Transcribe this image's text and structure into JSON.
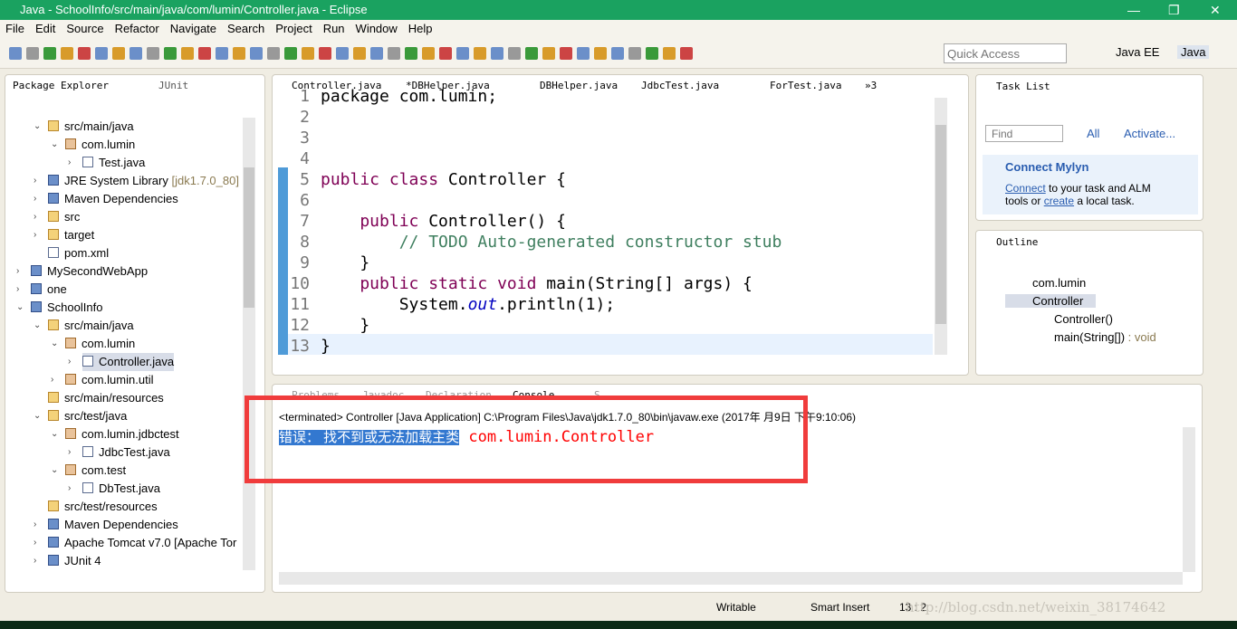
{
  "window": {
    "title": "Java - SchoolInfo/src/main/java/com/lumin/Controller.java - Eclipse"
  },
  "menu": [
    "File",
    "Edit",
    "Source",
    "Refactor",
    "Navigate",
    "Search",
    "Project",
    "Run",
    "Window",
    "Help"
  ],
  "quick_access": {
    "placeholder": "Quick Access"
  },
  "perspectives": [
    "Java EE",
    "Java"
  ],
  "package_explorer": {
    "tabs": [
      "Package Explorer",
      "JUnit"
    ],
    "items": [
      {
        "label": "src/main/java",
        "type": "folder",
        "depth": 1,
        "open": true
      },
      {
        "label": "com.lumin",
        "type": "package",
        "depth": 2,
        "open": true
      },
      {
        "label": "Test.java",
        "type": "java",
        "depth": 3
      },
      {
        "label": "JRE System Library",
        "suffix": "[jdk1.7.0_80]",
        "type": "lib",
        "depth": 1
      },
      {
        "label": "Maven Dependencies",
        "type": "lib",
        "depth": 1
      },
      {
        "label": "src",
        "type": "folder",
        "depth": 1
      },
      {
        "label": "target",
        "type": "folder",
        "depth": 1
      },
      {
        "label": "pom.xml",
        "type": "file",
        "depth": 1,
        "leaf": true
      },
      {
        "label": "MySecondWebApp",
        "type": "project",
        "depth": 0
      },
      {
        "label": "one",
        "type": "project",
        "depth": 0
      },
      {
        "label": "SchoolInfo",
        "type": "project",
        "depth": 0,
        "open": true
      },
      {
        "label": "src/main/java",
        "type": "folder",
        "depth": 1,
        "open": true
      },
      {
        "label": "com.lumin",
        "type": "package",
        "depth": 2,
        "open": true
      },
      {
        "label": "Controller.java",
        "type": "java",
        "depth": 3,
        "selected": true
      },
      {
        "label": "com.lumin.util",
        "type": "package",
        "depth": 2
      },
      {
        "label": "src/main/resources",
        "type": "folder",
        "depth": 1,
        "leaf": true
      },
      {
        "label": "src/test/java",
        "type": "folder",
        "depth": 1,
        "open": true
      },
      {
        "label": "com.lumin.jdbctest",
        "type": "package",
        "depth": 2,
        "open": true
      },
      {
        "label": "JdbcTest.java",
        "type": "java",
        "depth": 3
      },
      {
        "label": "com.test",
        "type": "package",
        "depth": 2,
        "open": true
      },
      {
        "label": "DbTest.java",
        "type": "java",
        "depth": 3
      },
      {
        "label": "src/test/resources",
        "type": "folder",
        "depth": 1,
        "leaf": true
      },
      {
        "label": "Maven Dependencies",
        "type": "lib",
        "depth": 1
      },
      {
        "label": "Apache Tomcat v7.0 [Apache Tor",
        "type": "lib",
        "depth": 1
      },
      {
        "label": "JUnit 4",
        "type": "lib",
        "depth": 1
      }
    ]
  },
  "editor": {
    "tabs": [
      "Controller.java",
      "*DBHelper.java",
      "DBHelper.java",
      "JdbcTest.java",
      "ForTest.java"
    ],
    "overflow": "»3",
    "lines": [
      {
        "n": "1",
        "parts": [
          [
            "package com.lumin;",
            ""
          ]
        ]
      },
      {
        "n": "2",
        "parts": []
      },
      {
        "n": "3",
        "parts": []
      },
      {
        "n": "4",
        "parts": []
      },
      {
        "n": "5",
        "parts": [
          [
            "public class",
            "kw"
          ],
          [
            " Controller {",
            ""
          ]
        ]
      },
      {
        "n": "6",
        "parts": []
      },
      {
        "n": "7",
        "parts": [
          [
            "    public",
            "kw"
          ],
          [
            " Controller() {",
            ""
          ]
        ]
      },
      {
        "n": "8",
        "parts": [
          [
            "        // TODO Auto-generated constructor stub",
            "cm"
          ]
        ]
      },
      {
        "n": "9",
        "parts": [
          [
            "    }",
            ""
          ]
        ]
      },
      {
        "n": "10",
        "parts": [
          [
            "    public static void",
            "kw"
          ],
          [
            " main(String[] args) {",
            ""
          ]
        ]
      },
      {
        "n": "11",
        "parts": [
          [
            "        System.",
            ""
          ],
          [
            "out",
            "it"
          ],
          [
            ".println(1);",
            ""
          ]
        ]
      },
      {
        "n": "12",
        "parts": [
          [
            "    }",
            ""
          ]
        ]
      },
      {
        "n": "13",
        "parts": [
          [
            "}",
            ""
          ]
        ]
      }
    ]
  },
  "task_list": {
    "title": "Task List",
    "find_placeholder": "Find",
    "all": "All",
    "activate": "Activate...",
    "mylyn_title": "Connect Mylyn",
    "mylyn_link1": "Connect",
    "mylyn_text1": " to your task and ALM",
    "mylyn_text2": "tools or ",
    "mylyn_link2": "create",
    "mylyn_text3": " a local task."
  },
  "outline": {
    "title": "Outline",
    "items": [
      "com.lumin",
      "Controller",
      "Controller()",
      "main(String[])"
    ],
    "main_type": " : void"
  },
  "console": {
    "tabs": [
      "Problems",
      "Javadoc",
      "Declaration",
      "Console",
      "S"
    ],
    "header": "<terminated> Controller [Java Application] C:\\Program Files\\Java\\jdk1.7.0_80\\bin\\javaw.exe (2017年 月9日 下午9:10:06)",
    "error_highlight": "错误： 找不到或无法加载主类",
    "error_class": " com.lumin.Controller"
  },
  "status": {
    "writable": "Writable",
    "insert": "Smart Insert",
    "position": "13 : 2",
    "watermark": "http://blog.csdn.net/weixin_38174642"
  },
  "colors": {
    "title_bar": "#1aa260",
    "highlight": "#3378d0",
    "error": "#ff0000",
    "annotation_box": "#f03c3c"
  }
}
